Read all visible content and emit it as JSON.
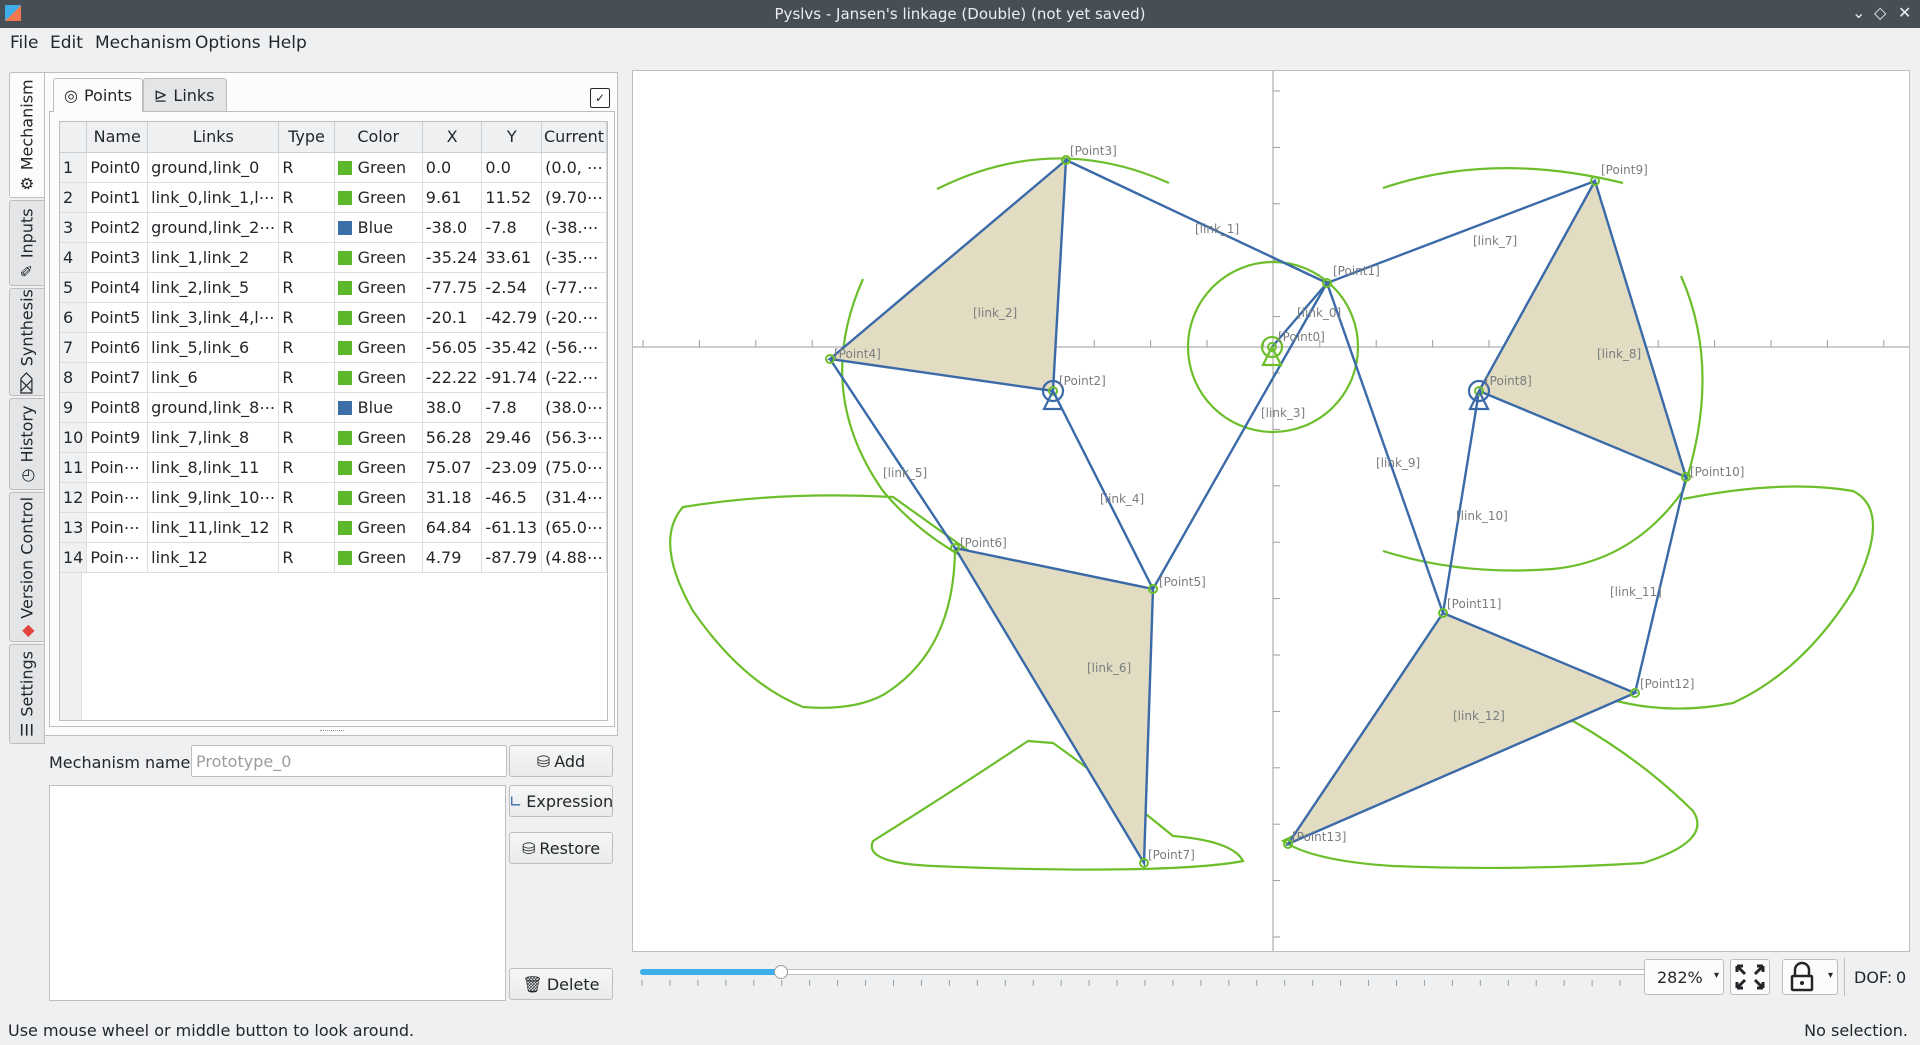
{
  "window": {
    "title": "Pyslvs - Jansen's linkage (Double) (not yet saved)"
  },
  "menu": [
    "File",
    "Edit",
    "Mechanism",
    "Options",
    "Help"
  ],
  "side_tabs": [
    "Mechanism",
    "Inputs",
    "Synthesis",
    "History",
    "Version Control",
    "Settings"
  ],
  "inner_tabs": {
    "points": "Points",
    "links": "Links"
  },
  "table": {
    "headers": [
      "Name",
      "Links",
      "Type",
      "Color",
      "X",
      "Y",
      "Current"
    ],
    "rows": [
      {
        "n": "1",
        "name": "Point0",
        "links": "ground,link_0",
        "type": "R",
        "color": "Green",
        "x": "0.0",
        "y": "0.0",
        "cur": "(0.0, ⋯"
      },
      {
        "n": "2",
        "name": "Point1",
        "links": "link_0,link_1,l⋯",
        "type": "R",
        "color": "Green",
        "x": "9.61",
        "y": "11.52",
        "cur": "(9.70⋯"
      },
      {
        "n": "3",
        "name": "Point2",
        "links": "ground,link_2⋯",
        "type": "R",
        "color": "Blue",
        "x": "-38.0",
        "y": "-7.8",
        "cur": "(-38.⋯"
      },
      {
        "n": "4",
        "name": "Point3",
        "links": "link_1,link_2",
        "type": "R",
        "color": "Green",
        "x": "-35.24",
        "y": "33.61",
        "cur": "(-35.⋯"
      },
      {
        "n": "5",
        "name": "Point4",
        "links": "link_2,link_5",
        "type": "R",
        "color": "Green",
        "x": "-77.75",
        "y": "-2.54",
        "cur": "(-77.⋯"
      },
      {
        "n": "6",
        "name": "Point5",
        "links": "link_3,link_4,l⋯",
        "type": "R",
        "color": "Green",
        "x": "-20.1",
        "y": "-42.79",
        "cur": "(-20.⋯"
      },
      {
        "n": "7",
        "name": "Point6",
        "links": "link_5,link_6",
        "type": "R",
        "color": "Green",
        "x": "-56.05",
        "y": "-35.42",
        "cur": "(-56.⋯"
      },
      {
        "n": "8",
        "name": "Point7",
        "links": "link_6",
        "type": "R",
        "color": "Green",
        "x": "-22.22",
        "y": "-91.74",
        "cur": "(-22.⋯"
      },
      {
        "n": "9",
        "name": "Point8",
        "links": "ground,link_8⋯",
        "type": "R",
        "color": "Blue",
        "x": "38.0",
        "y": "-7.8",
        "cur": "(38.0⋯"
      },
      {
        "n": "10",
        "name": "Point9",
        "links": "link_7,link_8",
        "type": "R",
        "color": "Green",
        "x": "56.28",
        "y": "29.46",
        "cur": "(56.3⋯"
      },
      {
        "n": "11",
        "name": "Poin⋯",
        "links": "link_8,link_11",
        "type": "R",
        "color": "Green",
        "x": "75.07",
        "y": "-23.09",
        "cur": "(75.0⋯"
      },
      {
        "n": "12",
        "name": "Poin⋯",
        "links": "link_9,link_10⋯",
        "type": "R",
        "color": "Green",
        "x": "31.18",
        "y": "-46.5",
        "cur": "(31.4⋯"
      },
      {
        "n": "13",
        "name": "Poin⋯",
        "links": "link_11,link_12",
        "type": "R",
        "color": "Green",
        "x": "64.84",
        "y": "-61.13",
        "cur": "(65.0⋯"
      },
      {
        "n": "14",
        "name": "Poin⋯",
        "links": "link_12",
        "type": "R",
        "color": "Green",
        "x": "4.79",
        "y": "-87.79",
        "cur": "(4.88⋯"
      }
    ]
  },
  "colors": {
    "Green": "#5cb829",
    "Blue": "#3c6fa8",
    "link": "#3a6aa8",
    "curve": "#6cbe2a",
    "face": "#e2dcc2"
  },
  "mechanism": {
    "name_label": "Mechanism name:",
    "name_placeholder": "Prototype_0",
    "add": "Add",
    "expression": "Expression",
    "restore": "Restore",
    "delete": "Delete"
  },
  "canvas_labels": {
    "points": [
      "[Point0]",
      "[Point1]",
      "[Point2]",
      "[Point3]",
      "[Point4]",
      "[Point5]",
      "[Point6]",
      "[Point7]",
      "[Point8]",
      "[Point9]",
      "[Point10]",
      "[Point11]",
      "[Point12]",
      "[Point13]"
    ],
    "links": [
      "[link_0]",
      "[link_1]",
      "[link_2]",
      "[link_3]",
      "[link_4]",
      "[link_5]",
      "[link_6]",
      "[link_7]",
      "[link_8]",
      "[link_9]",
      "[link_10]",
      "[link_11]",
      "[link_12]"
    ]
  },
  "zoom": {
    "value": "282%"
  },
  "slider": {
    "fraction": 0.14
  },
  "dof": {
    "label": "DOF:",
    "value": "0"
  },
  "status": {
    "left": "Use mouse wheel or middle button to look around.",
    "right": "No selection."
  }
}
